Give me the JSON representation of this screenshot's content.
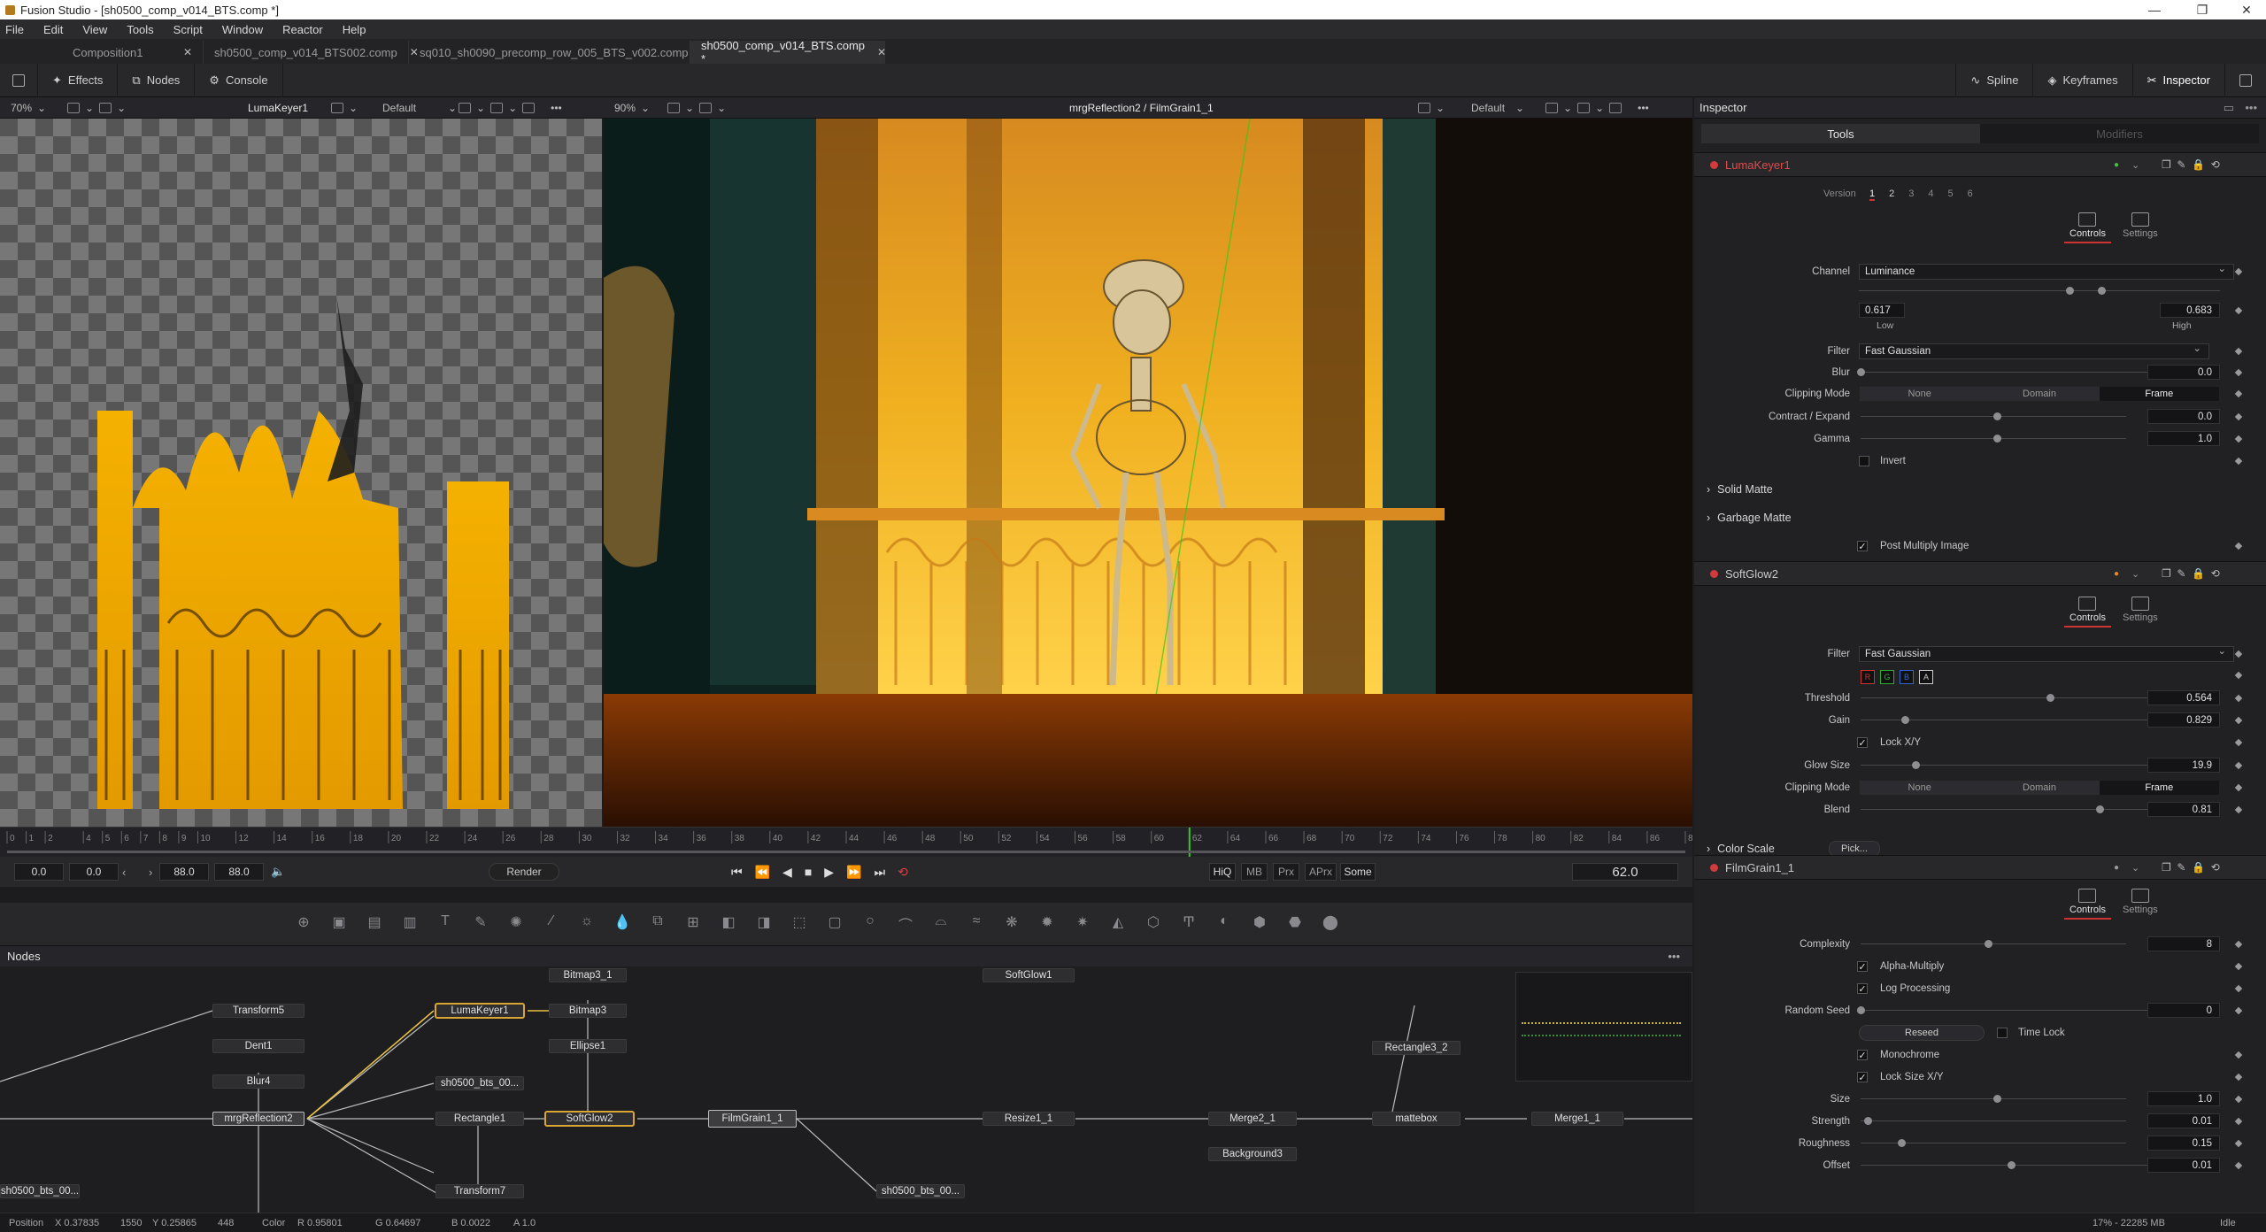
{
  "window": {
    "title": "Fusion Studio - [sh0500_comp_v014_BTS.comp *]"
  },
  "menu": [
    "File",
    "Edit",
    "View",
    "Tools",
    "Script",
    "Window",
    "Reactor",
    "Help"
  ],
  "doc_tabs": [
    {
      "label": "Composition1",
      "active": false
    },
    {
      "label": "sh0500_comp_v014_BTS002.comp",
      "active": false
    },
    {
      "label": "sq010_sh0090_precomp_row_005_BTS_v002.comp",
      "active": false
    },
    {
      "label": "sh0500_comp_v014_BTS.comp *",
      "active": true
    }
  ],
  "toolbar": {
    "effects": "Effects",
    "nodes": "Nodes",
    "console": "Console",
    "spline": "Spline",
    "keyframes": "Keyframes",
    "inspector": "Inspector"
  },
  "viewer_left": {
    "zoom": "70%",
    "tool": "LumaKeyer1",
    "lut": "Default"
  },
  "viewer_right": {
    "zoom": "90%",
    "tool": "mrgReflection2 / FilmGrain1_1",
    "lut": "Default"
  },
  "ruler": {
    "ticks": [
      "0",
      "1",
      "2",
      "4",
      "5",
      "6",
      "7",
      "8",
      "9",
      "10",
      "12",
      "14",
      "16",
      "18",
      "20",
      "22",
      "24",
      "26",
      "28",
      "30",
      "32",
      "34",
      "36",
      "38",
      "40",
      "42",
      "44",
      "46",
      "48",
      "50",
      "52",
      "54",
      "56",
      "58",
      "60",
      "62",
      "64",
      "66",
      "68",
      "70",
      "72",
      "74",
      "76",
      "78",
      "80",
      "82",
      "84",
      "86",
      "88"
    ],
    "current": 62
  },
  "transport": {
    "start": "0.0",
    "render_start": "0.0",
    "render_end": "88.0",
    "end": "88.0",
    "render": "Render",
    "hiq": "HiQ",
    "mb": "MB",
    "prx": "Prx",
    "aprx": "APrx",
    "some": "Some",
    "current_time": "62.0"
  },
  "nodes_panel": {
    "title": "Nodes"
  },
  "nodes": [
    {
      "label": "Transform5"
    },
    {
      "label": "Dent1"
    },
    {
      "label": "Blur4"
    },
    {
      "label": "mrgReflection2"
    },
    {
      "label": "LumaKeyer1"
    },
    {
      "label": "sh0500_bts_00..."
    },
    {
      "label": "Rectangle1"
    },
    {
      "label": "Transform7"
    },
    {
      "label": "Bitmap3_1"
    },
    {
      "label": "Bitmap3"
    },
    {
      "label": "Ellipse1"
    },
    {
      "label": "SoftGlow2"
    },
    {
      "label": "FilmGrain1_1"
    },
    {
      "label": "sh0500_bts_00..."
    },
    {
      "label": "SoftGlow1"
    },
    {
      "label": "Resize1_1"
    },
    {
      "label": "Merge2_1"
    },
    {
      "label": "Background3"
    },
    {
      "label": "Rectangle3_2"
    },
    {
      "label": "mattebox"
    },
    {
      "label": "Merge1_1"
    },
    {
      "label": "sh0500_bts_00..."
    }
  ],
  "status": {
    "position": "Position",
    "x": "X 0.37835",
    "y": "Y 0.25865",
    "px": "1550",
    "py": "448",
    "color": "Color",
    "r": "R 0.95801",
    "g": "G 0.64697",
    "b": "B 0.0022",
    "a": "A 1.0",
    "mem": "17% - 22285 MB",
    "state": "Idle"
  },
  "inspector": {
    "title": "Inspector",
    "tab_tools": "Tools",
    "tab_modifiers": "Modifiers",
    "controls": "Controls",
    "settings": "Settings",
    "luma": {
      "name": "LumaKeyer1",
      "version_label": "Version",
      "versions": [
        "1",
        "2",
        "3",
        "4",
        "5",
        "6"
      ],
      "channel_label": "Channel",
      "channel": "Luminance",
      "low": "0.617",
      "high": "0.683",
      "low_label": "Low",
      "high_label": "High",
      "filter_label": "Filter",
      "filter": "Fast Gaussian",
      "blur_label": "Blur",
      "blur": "0.0",
      "clip_label": "Clipping Mode",
      "clip_opts": [
        "None",
        "Domain",
        "Frame"
      ],
      "contract_label": "Contract / Expand",
      "contract": "0.0",
      "gamma_label": "Gamma",
      "gamma": "1.0",
      "invert": "Invert",
      "solid": "Solid Matte",
      "garbage": "Garbage Matte",
      "postmult": "Post Multiply Image"
    },
    "soft": {
      "name": "SoftGlow2",
      "filter_label": "Filter",
      "filter": "Fast Gaussian",
      "rgba": [
        "R",
        "G",
        "B",
        "A"
      ],
      "threshold_label": "Threshold",
      "threshold": "0.564",
      "gain_label": "Gain",
      "gain": "0.829",
      "lockxy": "Lock X/Y",
      "glow_label": "Glow Size",
      "glow": "19.9",
      "clip_label": "Clipping Mode",
      "clip_opts": [
        "None",
        "Domain",
        "Frame"
      ],
      "blend_label": "Blend",
      "blend": "0.81",
      "colorscale": "Color Scale",
      "pick": "Pick..."
    },
    "grain": {
      "name": "FilmGrain1_1",
      "complexity_label": "Complexity",
      "complexity": "8",
      "alpha": "Alpha-Multiply",
      "log": "Log Processing",
      "seed_label": "Random Seed",
      "seed": "0",
      "reseed": "Reseed",
      "timelock": "Time Lock",
      "mono": "Monochrome",
      "locksize": "Lock Size X/Y",
      "size_label": "Size",
      "size": "1.0",
      "strength_label": "Strength",
      "strength": "0.01",
      "rough_label": "Roughness",
      "rough": "0.15",
      "offset_label": "Offset",
      "offset": "0.01"
    }
  },
  "colors": {
    "accent": "#d23b3b",
    "selection": "#d9a635",
    "fire": "#f0a500"
  }
}
